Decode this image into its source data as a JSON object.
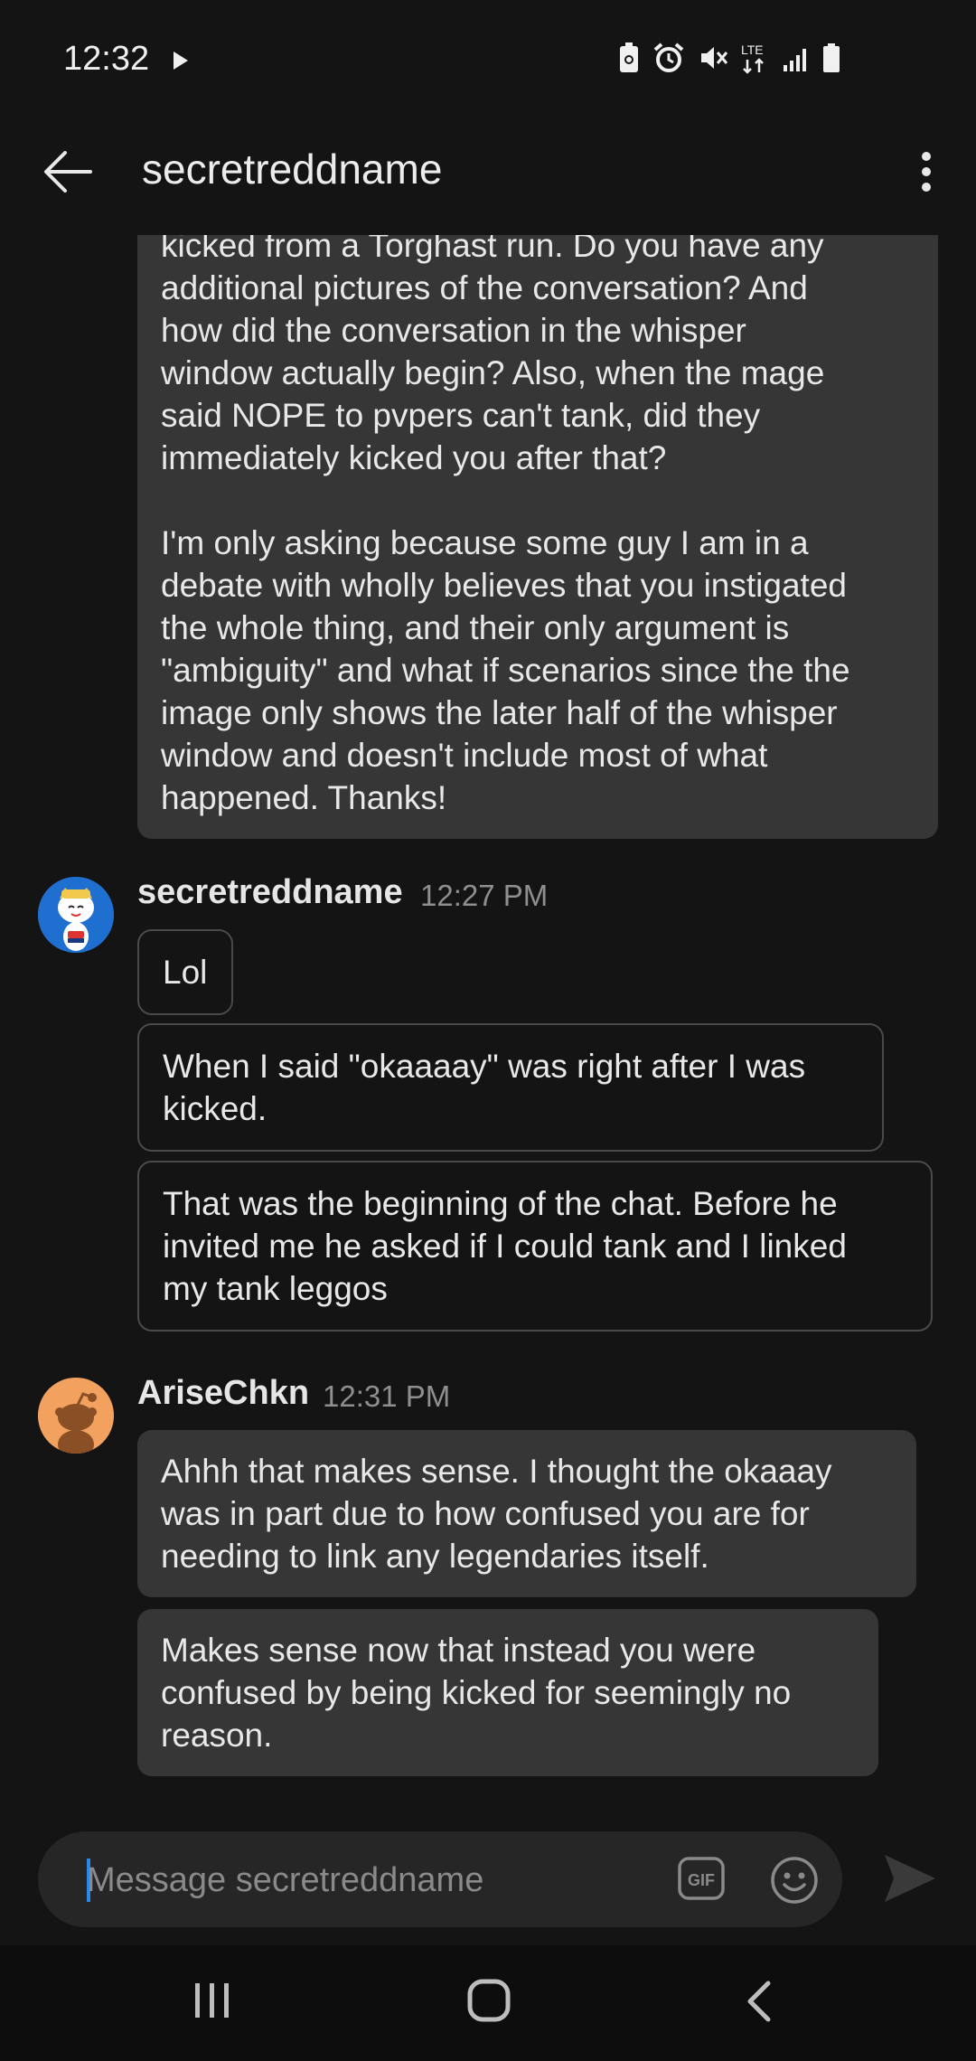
{
  "status_bar": {
    "time": "12:32",
    "network_label": "LTE",
    "icons": [
      "play-icon",
      "battery-saver-icon",
      "alarm-icon",
      "mute-icon",
      "lte-icon",
      "signal-icon",
      "battery-icon"
    ]
  },
  "header": {
    "title": "secretreddname",
    "back_icon": "arrow-left-icon",
    "menu_icon": "more-vertical-icon"
  },
  "messages": {
    "prev_bubble_text": "kicked from a Torghast run. Do you have any\nadditional pictures of the conversation? And\nhow did the conversation in the whisper\nwindow actually begin? Also, when the mage\nsaid NOPE to pvpers can't tank, did they\nimmediately kicked you after that?\n\nI'm only asking because some guy I am in a\ndebate with wholly believes that you instigated\nthe whole thing, and their only argument is\n\"ambiguity\" and what if scenarios since the the\nimage only shows the later half of the whisper\nwindow and doesn't include most of what\nhappened. Thanks!",
    "group1": {
      "author": "secretreddname",
      "time": "12:27 PM",
      "bubbles": [
        "Lol",
        "When I said \"okaaaay\" was right after I was\nkicked.",
        "That was the beginning of the chat. Before he\ninvited me he asked if I could tank and I linked\nmy tank leggos"
      ]
    },
    "group2": {
      "author": "AriseChkn",
      "time": "12:31 PM",
      "bubbles": [
        "Ahhh that makes sense. I thought the okaaay\nwas in part due to how confused you are for\nneeding to link any legendaries itself.",
        "Makes sense now that instead you were\nconfused by being kicked for seemingly no\nreason."
      ]
    }
  },
  "composer": {
    "placeholder": "Message secretreddname",
    "value": "",
    "gif_label": "GIF"
  },
  "colors": {
    "background": "#141414",
    "bubble_fill": "#363636",
    "bubble_border": "#4a4a4a",
    "accent_cursor": "#2b88e6",
    "avatar1_bg": "#1f6fd0",
    "avatar2_bg": "#f2a25e"
  }
}
